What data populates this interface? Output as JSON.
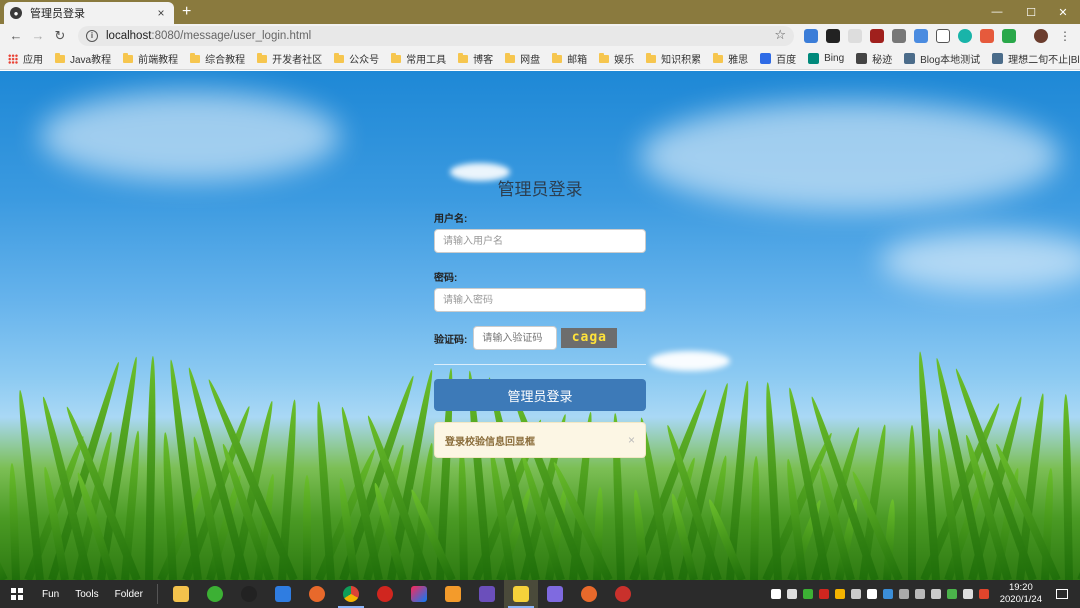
{
  "browser": {
    "tab": {
      "title": "管理员登录",
      "close": "×"
    },
    "new_tab": "+",
    "window_controls": {
      "minimize": "—",
      "maximize": "☐",
      "close": "✕"
    },
    "nav": {
      "back": "←",
      "forward": "→",
      "reload": "↻"
    },
    "url": {
      "host": "localhost",
      "path": ":8080/message/user_login.html"
    },
    "star": "☆",
    "bookmarks": [
      {
        "label": "应用",
        "icon": "apps-icon"
      },
      {
        "label": "Java教程",
        "icon": "folder-icon"
      },
      {
        "label": "前端教程",
        "icon": "folder-icon"
      },
      {
        "label": "综合教程",
        "icon": "folder-icon"
      },
      {
        "label": "开发者社区",
        "icon": "folder-icon"
      },
      {
        "label": "公众号",
        "icon": "folder-icon"
      },
      {
        "label": "常用工具",
        "icon": "folder-icon"
      },
      {
        "label": "博客",
        "icon": "folder-icon"
      },
      {
        "label": "网盘",
        "icon": "folder-icon"
      },
      {
        "label": "邮箱",
        "icon": "folder-icon"
      },
      {
        "label": "娱乐",
        "icon": "folder-icon"
      },
      {
        "label": "知识积累",
        "icon": "folder-icon"
      },
      {
        "label": "雅思",
        "icon": "folder-icon"
      },
      {
        "label": "百度",
        "icon": "baidu-icon"
      },
      {
        "label": "Bing",
        "icon": "bing-icon"
      },
      {
        "label": "秘迹",
        "icon": "mijisou-icon"
      },
      {
        "label": "Blog本地测试",
        "icon": "page-icon"
      },
      {
        "label": "理想二旬不止|Blog",
        "icon": "page-icon"
      }
    ]
  },
  "login": {
    "title": "管理员登录",
    "username_label": "用户名:",
    "username_placeholder": "请输入用户名",
    "password_label": "密码:",
    "password_placeholder": "请输入密码",
    "captcha_label": "验证码:",
    "captcha_placeholder": "请输入验证码",
    "captcha_text": "caga",
    "submit_label": "管理员登录",
    "alert_text": "登录校验信息回显框",
    "alert_close": "×"
  },
  "taskbar": {
    "quick": [
      "Fun",
      "Tools",
      "Folder"
    ],
    "clock_time": "19:20",
    "clock_date": "2020/1/24"
  },
  "colors": {
    "primary_button": "#3d7ab8",
    "alert_bg": "#fcf6e4",
    "alert_text": "#8a6d3b",
    "captcha_text": "#ffe23a"
  }
}
